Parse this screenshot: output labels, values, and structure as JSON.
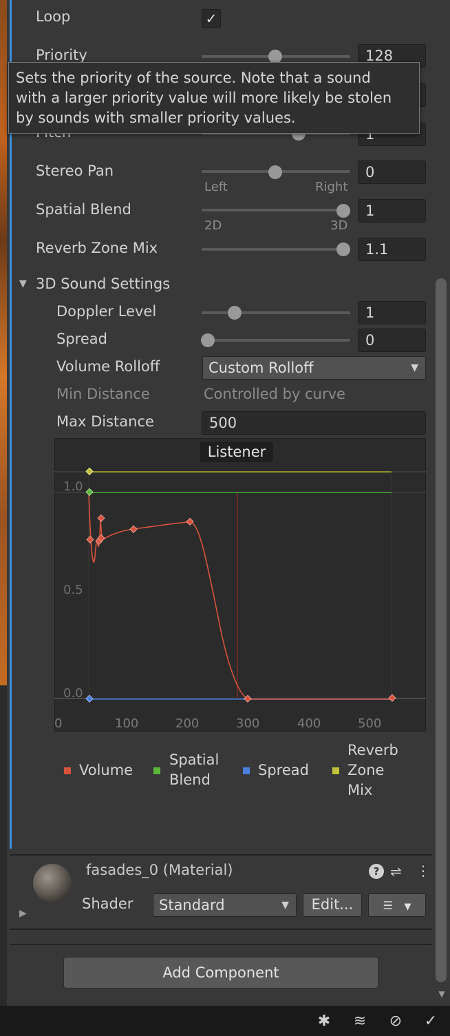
{
  "audio": {
    "loop_label": "Loop",
    "loop_checked": true,
    "priority_label": "Priority",
    "priority_value": "128",
    "pitch_label": "Pitch",
    "pitch_value": "1",
    "stereo_pan_label": "Stereo Pan",
    "stereo_pan_value": "0",
    "stereo_pan_left": "Left",
    "stereo_pan_right": "Right",
    "spatial_blend_label": "Spatial Blend",
    "spatial_blend_value": "1",
    "spatial_blend_2d": "2D",
    "spatial_blend_3d": "3D",
    "reverb_label": "Reverb Zone Mix",
    "reverb_value": "1.1"
  },
  "tooltip": {
    "line1": "Sets the priority of the source. Note that a sound",
    "line2": "with a larger priority value will more likely be stolen",
    "line3": "by sounds with smaller priority values."
  },
  "sound3d": {
    "header": "3D Sound Settings",
    "doppler_label": "Doppler Level",
    "doppler_value": "1",
    "spread_label": "Spread",
    "spread_value": "0",
    "rolloff_label": "Volume Rolloff",
    "rolloff_value": "Custom Rolloff",
    "min_label": "Min Distance",
    "min_value": "Controlled by curve",
    "max_label": "Max Distance",
    "max_value": "500"
  },
  "curve": {
    "listener": "Listener",
    "y_ticks": [
      "1.0",
      "0.5",
      "0.0"
    ],
    "x_ticks": [
      "0",
      "100",
      "200",
      "300",
      "400",
      "500"
    ],
    "legend": [
      {
        "name_lines": [
          "Volume"
        ],
        "color": "#d8533d"
      },
      {
        "name_lines": [
          "Spatial",
          "Blend"
        ],
        "color": "#5cb83d"
      },
      {
        "name_lines": [
          "Spread"
        ],
        "color": "#4a7fe0"
      },
      {
        "name_lines": [
          "Reverb",
          "Zone",
          "Mix"
        ],
        "color": "#c2c23a"
      }
    ]
  },
  "material": {
    "title": "fasades_0 (Material)",
    "shader_label": "Shader",
    "shader_value": "Standard",
    "edit_button": "Edit..."
  },
  "add_component": "Add Component"
}
